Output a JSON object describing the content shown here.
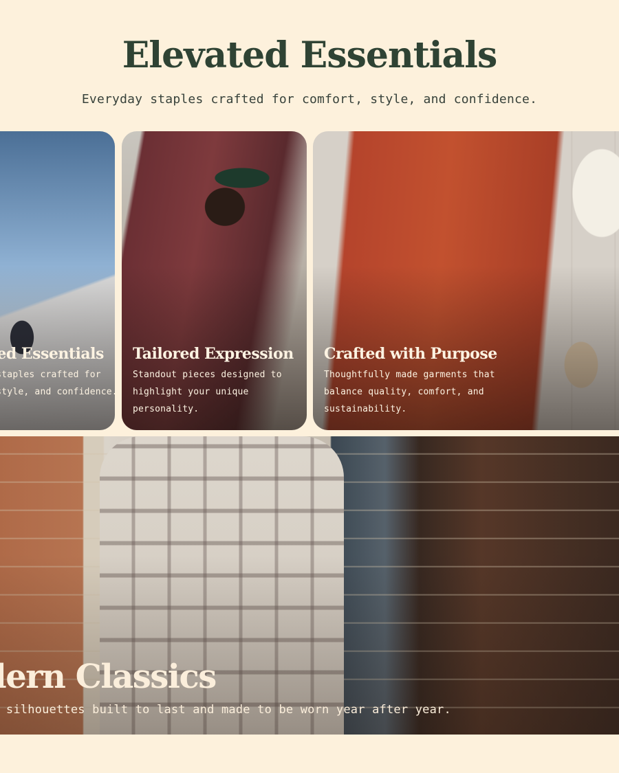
{
  "header": {
    "title": "Elevated Essentials",
    "subtitle": "Everyday staples crafted for comfort, style, and confidence."
  },
  "cards": [
    {
      "title": "Elevated Essentials",
      "text": "Everyday staples crafted for comfort, style, and confidence."
    },
    {
      "title": "Tailored Expression",
      "text": "Standout pieces designed to highlight your unique personality."
    },
    {
      "title": "Crafted with Purpose",
      "text": "Thoughtfully made garments that balance quality, comfort, and sustainability."
    }
  ],
  "hero": {
    "title": "Modern Classics",
    "text": "Timeless silhouettes built to last and made to be worn year after year."
  },
  "colors": {
    "background": "#fdf1dc",
    "heading": "#2f4334",
    "overlay_text": "#fdf3e2"
  }
}
